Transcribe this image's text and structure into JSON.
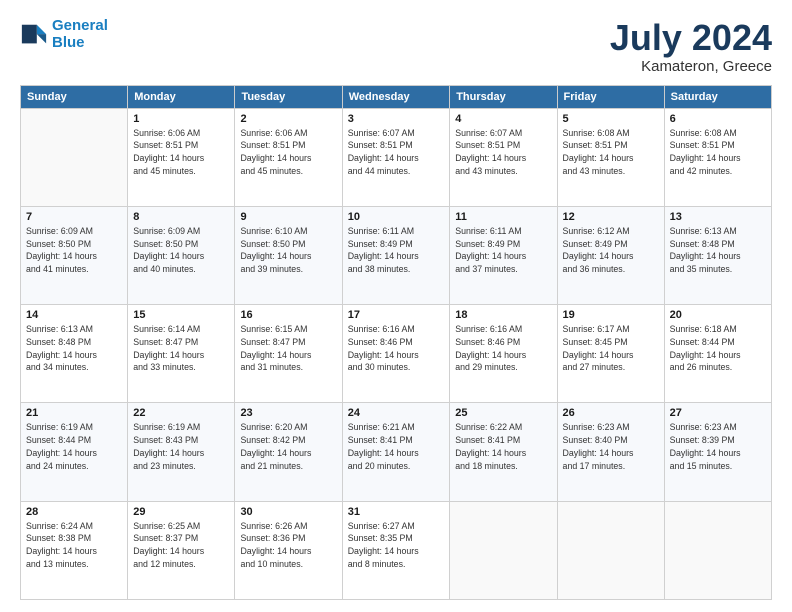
{
  "header": {
    "logo_line1": "General",
    "logo_line2": "Blue",
    "main_title": "July 2024",
    "sub_title": "Kamateron, Greece"
  },
  "days": [
    "Sunday",
    "Monday",
    "Tuesday",
    "Wednesday",
    "Thursday",
    "Friday",
    "Saturday"
  ],
  "weeks": [
    [
      {
        "date": "",
        "info": ""
      },
      {
        "date": "1",
        "info": "Sunrise: 6:06 AM\nSunset: 8:51 PM\nDaylight: 14 hours\nand 45 minutes."
      },
      {
        "date": "2",
        "info": "Sunrise: 6:06 AM\nSunset: 8:51 PM\nDaylight: 14 hours\nand 45 minutes."
      },
      {
        "date": "3",
        "info": "Sunrise: 6:07 AM\nSunset: 8:51 PM\nDaylight: 14 hours\nand 44 minutes."
      },
      {
        "date": "4",
        "info": "Sunrise: 6:07 AM\nSunset: 8:51 PM\nDaylight: 14 hours\nand 43 minutes."
      },
      {
        "date": "5",
        "info": "Sunrise: 6:08 AM\nSunset: 8:51 PM\nDaylight: 14 hours\nand 43 minutes."
      },
      {
        "date": "6",
        "info": "Sunrise: 6:08 AM\nSunset: 8:51 PM\nDaylight: 14 hours\nand 42 minutes."
      }
    ],
    [
      {
        "date": "7",
        "info": "Sunrise: 6:09 AM\nSunset: 8:50 PM\nDaylight: 14 hours\nand 41 minutes."
      },
      {
        "date": "8",
        "info": "Sunrise: 6:09 AM\nSunset: 8:50 PM\nDaylight: 14 hours\nand 40 minutes."
      },
      {
        "date": "9",
        "info": "Sunrise: 6:10 AM\nSunset: 8:50 PM\nDaylight: 14 hours\nand 39 minutes."
      },
      {
        "date": "10",
        "info": "Sunrise: 6:11 AM\nSunset: 8:49 PM\nDaylight: 14 hours\nand 38 minutes."
      },
      {
        "date": "11",
        "info": "Sunrise: 6:11 AM\nSunset: 8:49 PM\nDaylight: 14 hours\nand 37 minutes."
      },
      {
        "date": "12",
        "info": "Sunrise: 6:12 AM\nSunset: 8:49 PM\nDaylight: 14 hours\nand 36 minutes."
      },
      {
        "date": "13",
        "info": "Sunrise: 6:13 AM\nSunset: 8:48 PM\nDaylight: 14 hours\nand 35 minutes."
      }
    ],
    [
      {
        "date": "14",
        "info": "Sunrise: 6:13 AM\nSunset: 8:48 PM\nDaylight: 14 hours\nand 34 minutes."
      },
      {
        "date": "15",
        "info": "Sunrise: 6:14 AM\nSunset: 8:47 PM\nDaylight: 14 hours\nand 33 minutes."
      },
      {
        "date": "16",
        "info": "Sunrise: 6:15 AM\nSunset: 8:47 PM\nDaylight: 14 hours\nand 31 minutes."
      },
      {
        "date": "17",
        "info": "Sunrise: 6:16 AM\nSunset: 8:46 PM\nDaylight: 14 hours\nand 30 minutes."
      },
      {
        "date": "18",
        "info": "Sunrise: 6:16 AM\nSunset: 8:46 PM\nDaylight: 14 hours\nand 29 minutes."
      },
      {
        "date": "19",
        "info": "Sunrise: 6:17 AM\nSunset: 8:45 PM\nDaylight: 14 hours\nand 27 minutes."
      },
      {
        "date": "20",
        "info": "Sunrise: 6:18 AM\nSunset: 8:44 PM\nDaylight: 14 hours\nand 26 minutes."
      }
    ],
    [
      {
        "date": "21",
        "info": "Sunrise: 6:19 AM\nSunset: 8:44 PM\nDaylight: 14 hours\nand 24 minutes."
      },
      {
        "date": "22",
        "info": "Sunrise: 6:19 AM\nSunset: 8:43 PM\nDaylight: 14 hours\nand 23 minutes."
      },
      {
        "date": "23",
        "info": "Sunrise: 6:20 AM\nSunset: 8:42 PM\nDaylight: 14 hours\nand 21 minutes."
      },
      {
        "date": "24",
        "info": "Sunrise: 6:21 AM\nSunset: 8:41 PM\nDaylight: 14 hours\nand 20 minutes."
      },
      {
        "date": "25",
        "info": "Sunrise: 6:22 AM\nSunset: 8:41 PM\nDaylight: 14 hours\nand 18 minutes."
      },
      {
        "date": "26",
        "info": "Sunrise: 6:23 AM\nSunset: 8:40 PM\nDaylight: 14 hours\nand 17 minutes."
      },
      {
        "date": "27",
        "info": "Sunrise: 6:23 AM\nSunset: 8:39 PM\nDaylight: 14 hours\nand 15 minutes."
      }
    ],
    [
      {
        "date": "28",
        "info": "Sunrise: 6:24 AM\nSunset: 8:38 PM\nDaylight: 14 hours\nand 13 minutes."
      },
      {
        "date": "29",
        "info": "Sunrise: 6:25 AM\nSunset: 8:37 PM\nDaylight: 14 hours\nand 12 minutes."
      },
      {
        "date": "30",
        "info": "Sunrise: 6:26 AM\nSunset: 8:36 PM\nDaylight: 14 hours\nand 10 minutes."
      },
      {
        "date": "31",
        "info": "Sunrise: 6:27 AM\nSunset: 8:35 PM\nDaylight: 14 hours\nand 8 minutes."
      },
      {
        "date": "",
        "info": ""
      },
      {
        "date": "",
        "info": ""
      },
      {
        "date": "",
        "info": ""
      }
    ]
  ]
}
